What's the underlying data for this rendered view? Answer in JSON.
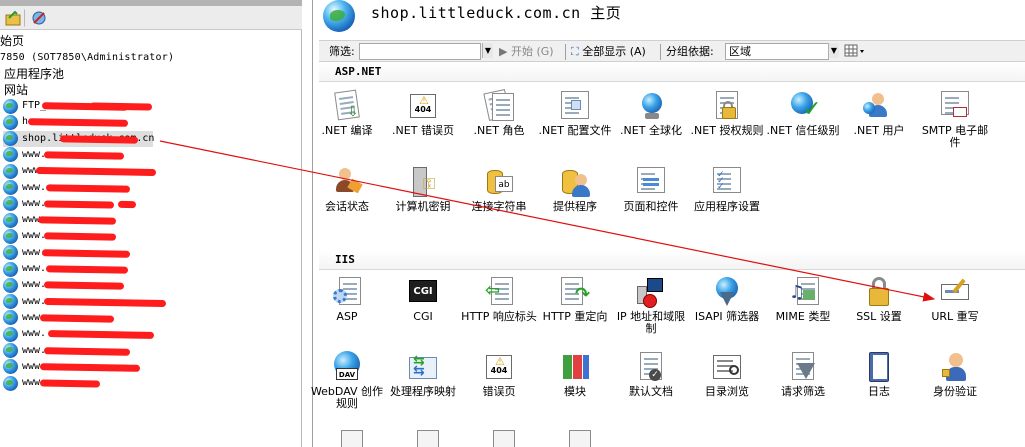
{
  "left_pane": {
    "tree": {
      "home": "始页",
      "server": "7850 (SOT7850\\Administrator)",
      "app_pools": "应用程序池",
      "sites": "网站"
    },
    "sites": [
      {
        "label": "FTP_"
      },
      {
        "label": "h"
      },
      {
        "label": "shop.littleduck.com.cn"
      },
      {
        "label": "www."
      },
      {
        "label": "www."
      },
      {
        "label": "www."
      },
      {
        "label": "www."
      },
      {
        "label": "www."
      },
      {
        "label": "www."
      },
      {
        "label": "www."
      },
      {
        "label": "www."
      },
      {
        "label": "www."
      },
      {
        "label": "www."
      },
      {
        "label": "www."
      },
      {
        "label": "www."
      },
      {
        "label": "www."
      },
      {
        "label": "www."
      },
      {
        "label": "www."
      }
    ]
  },
  "header": {
    "title": "shop.littleduck.com.cn 主页"
  },
  "filter_bar": {
    "filter_label": "筛选:",
    "start_label": "开始",
    "start_shortcut": "(G)",
    "show_all_label": "全部显示",
    "show_all_shortcut": "(A)",
    "group_by_label": "分组依据:",
    "group_by_value": "区域"
  },
  "groups": [
    {
      "name": "ASP.NET",
      "features": [
        {
          "label": ".NET 编译",
          "icon": "net-compile-icon"
        },
        {
          "label": ".NET 错误页",
          "icon": "net-error-pages-icon"
        },
        {
          "label": ".NET 角色",
          "icon": "net-roles-icon"
        },
        {
          "label": ".NET 配置文件",
          "icon": "net-profile-icon"
        },
        {
          "label": ".NET 全球化",
          "icon": "net-globalization-icon"
        },
        {
          "label": ".NET 授权规则",
          "icon": "net-authorization-icon"
        },
        {
          "label": ".NET 信任级别",
          "icon": "net-trust-levels-icon"
        },
        {
          "label": ".NET 用户",
          "icon": "net-users-icon"
        },
        {
          "label": "SMTP 电子邮件",
          "icon": "smtp-email-icon"
        },
        {
          "label": "会话状态",
          "icon": "session-state-icon"
        },
        {
          "label": "计算机密钥",
          "icon": "machine-key-icon"
        },
        {
          "label": "连接字符串",
          "icon": "connection-strings-icon"
        },
        {
          "label": "提供程序",
          "icon": "providers-icon"
        },
        {
          "label": "页面和控件",
          "icon": "pages-controls-icon"
        },
        {
          "label": "应用程序设置",
          "icon": "app-settings-icon"
        }
      ]
    },
    {
      "name": "IIS",
      "features": [
        {
          "label": "ASP",
          "icon": "asp-icon"
        },
        {
          "label": "CGI",
          "icon": "cgi-icon"
        },
        {
          "label": "HTTP 响应标头",
          "icon": "http-headers-icon"
        },
        {
          "label": "HTTP 重定向",
          "icon": "http-redirect-icon"
        },
        {
          "label": "IP 地址和域限制",
          "icon": "ip-restrictions-icon"
        },
        {
          "label": "ISAPI 筛选器",
          "icon": "isapi-filters-icon"
        },
        {
          "label": "MIME 类型",
          "icon": "mime-types-icon"
        },
        {
          "label": "SSL 设置",
          "icon": "ssl-settings-icon"
        },
        {
          "label": "URL 重写",
          "icon": "url-rewrite-icon"
        },
        {
          "label": "WebDAV 创作规则",
          "icon": "webdav-icon"
        },
        {
          "label": "处理程序映射",
          "icon": "handler-mappings-icon"
        },
        {
          "label": "错误页",
          "icon": "error-pages-icon"
        },
        {
          "label": "模块",
          "icon": "modules-icon"
        },
        {
          "label": "默认文档",
          "icon": "default-document-icon"
        },
        {
          "label": "目录浏览",
          "icon": "directory-browsing-icon"
        },
        {
          "label": "请求筛选",
          "icon": "request-filtering-icon"
        },
        {
          "label": "日志",
          "icon": "logging-icon"
        },
        {
          "label": "身份验证",
          "icon": "authentication-icon"
        }
      ]
    }
  ],
  "colors": {
    "annotation": "#e01010",
    "redaction": "#ff1c1c"
  }
}
